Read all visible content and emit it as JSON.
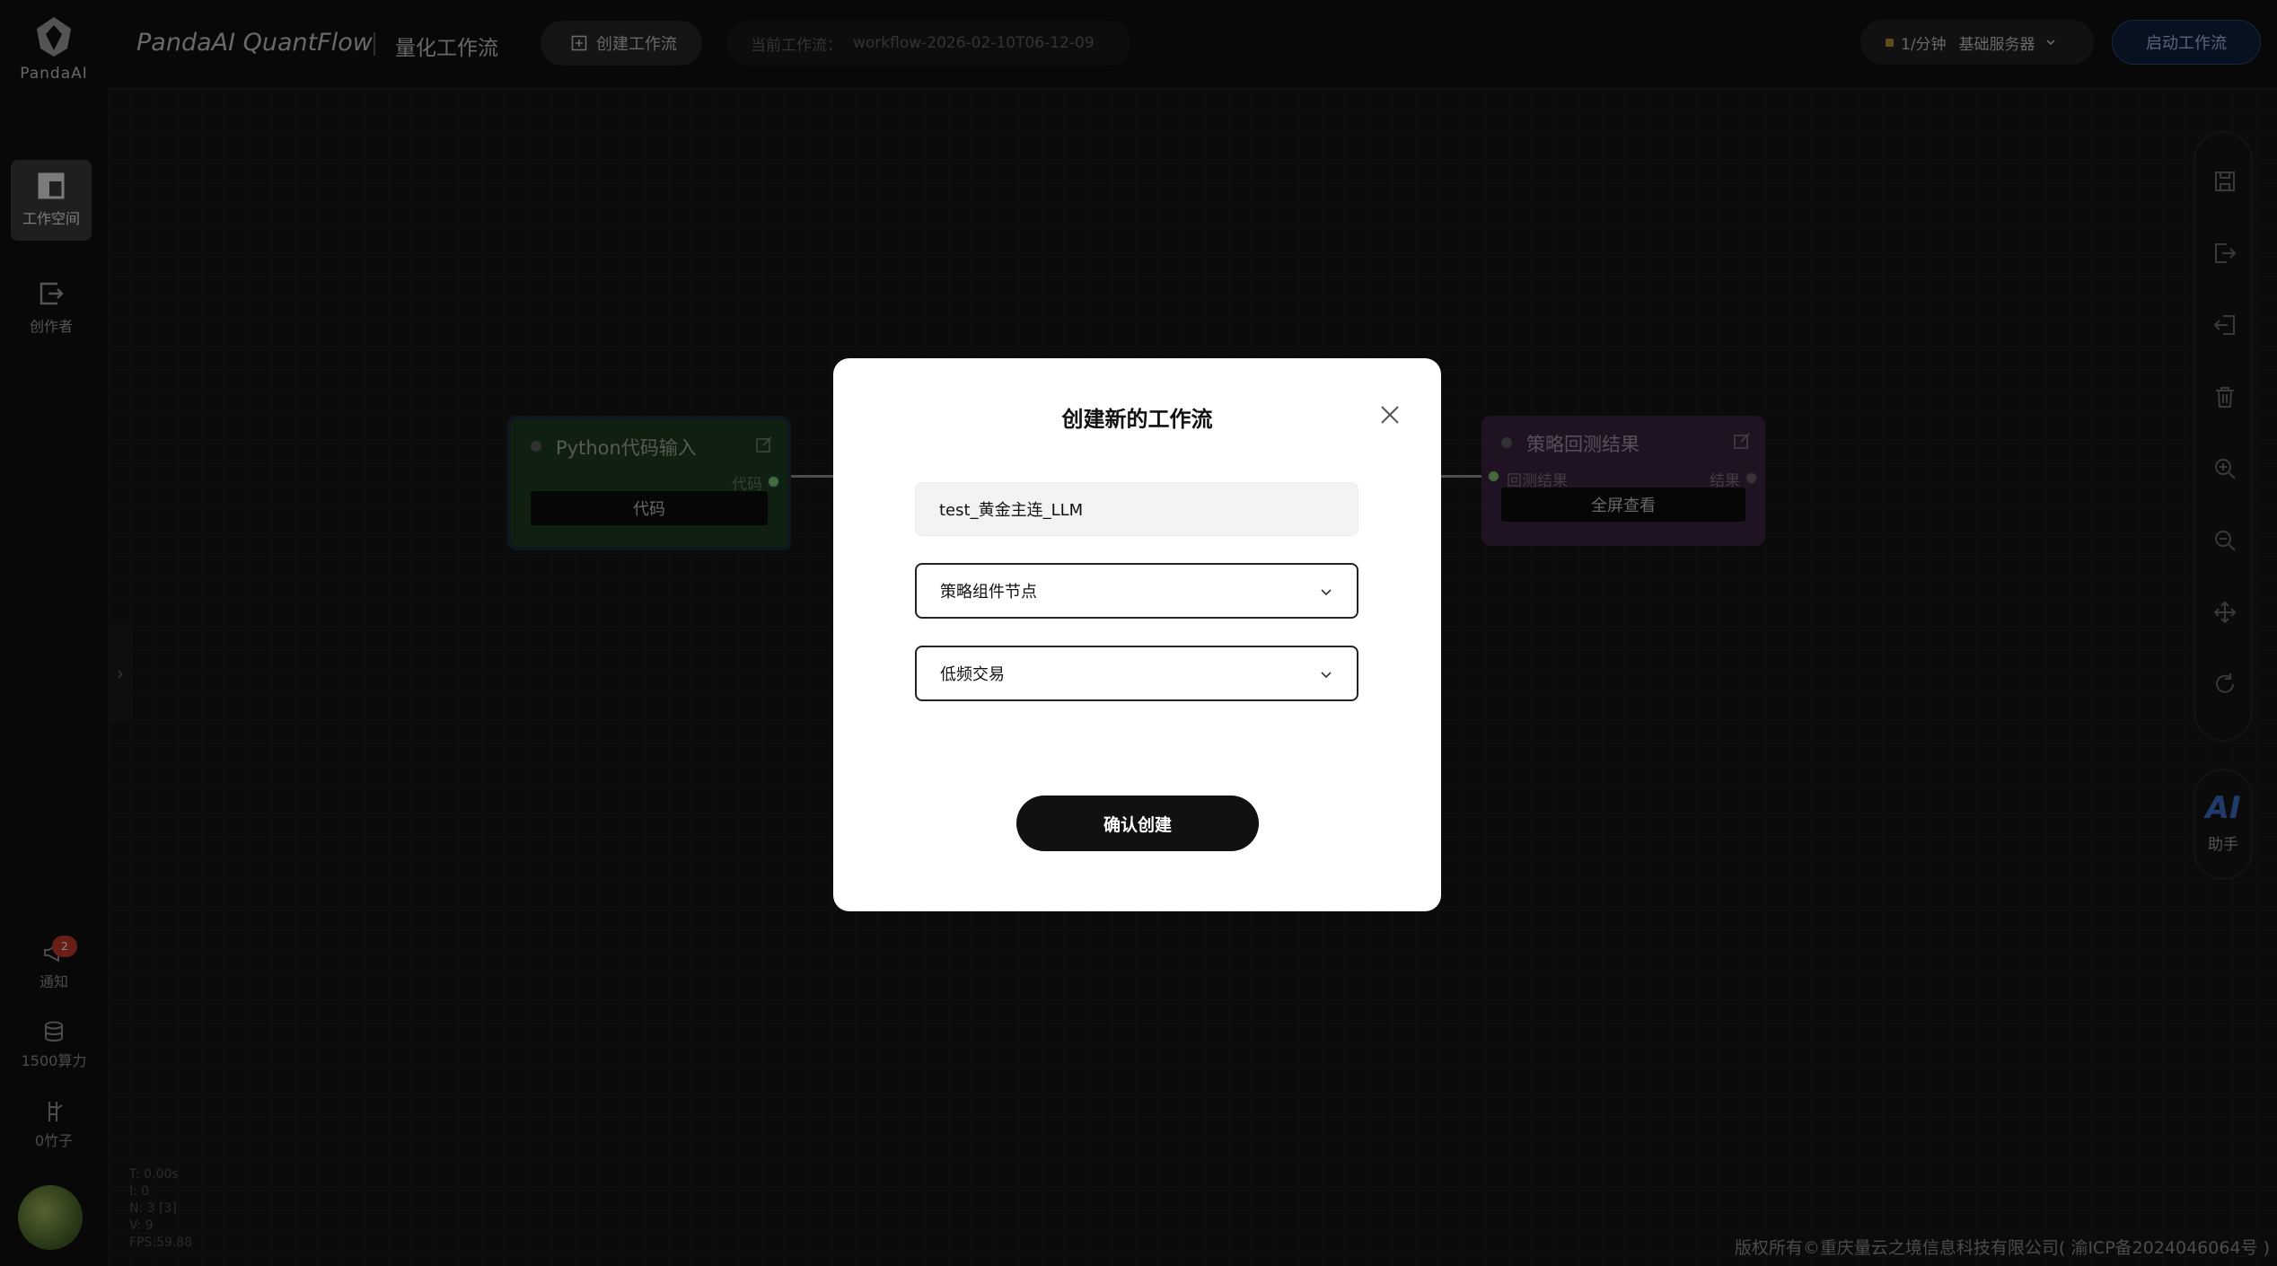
{
  "brand": {
    "logo_text": "PandaAI"
  },
  "sidebar": {
    "items": [
      {
        "label": "工作空间",
        "icon": "layout-icon",
        "active": true
      },
      {
        "label": "创作者",
        "icon": "export-icon",
        "active": false
      }
    ],
    "bottom": {
      "notifications": {
        "label": "通知",
        "badge": "2"
      },
      "compute": {
        "label": "1500算力"
      },
      "bamboo": {
        "label": "0竹子"
      }
    }
  },
  "header": {
    "app_title": "PandaAI QuantFlow",
    "app_subtitle": "量化工作流",
    "create_button": "创建工作流",
    "current_workflow_label": "当前工作流：",
    "current_workflow_value": "workflow-2026-02-10T06-12-09",
    "rate": "1/分钟",
    "server": "基础服务器",
    "start_button": "启动工作流"
  },
  "canvas": {
    "nodes": [
      {
        "title": "Python代码输入",
        "output_port": "代码",
        "button": "代码"
      },
      {
        "title": "策略回测结果",
        "input_port": "回测结果",
        "output_port": "结果",
        "button": "全屏查看"
      }
    ],
    "stats": {
      "t": "T: 0.00s",
      "i": "I: 0",
      "n": "N: 3 [3]",
      "v": "V: 9",
      "fps": "FPS:59.88"
    },
    "ai_assistant": {
      "badge": "AI",
      "label": "助手"
    }
  },
  "footer": {
    "copyright": "版权所有©重庆量云之境信息科技有限公司( 渝ICP备2024046064号 )"
  },
  "modal": {
    "title": "创建新的工作流",
    "name_value": "test_黄金主连_LLM",
    "category_selected": "策略组件节点",
    "type_selected": "低频交易",
    "confirm_button": "确认创建"
  }
}
